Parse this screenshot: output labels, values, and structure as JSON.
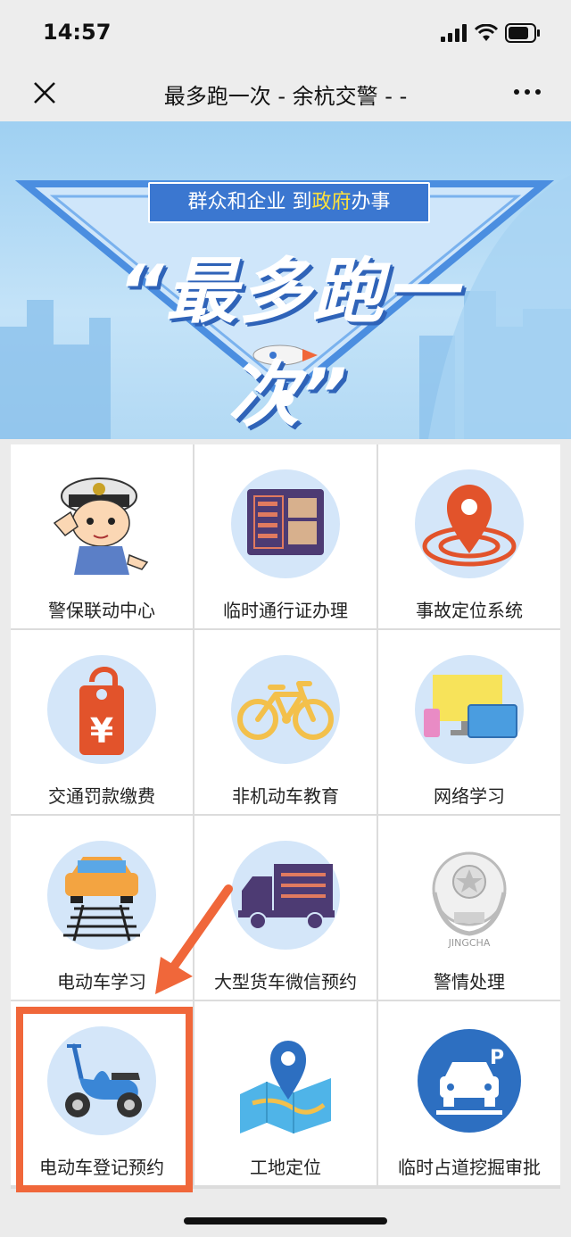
{
  "status": {
    "time": "14:57"
  },
  "nav": {
    "title": "最多跑一次 - 余杭交警 - -"
  },
  "banner": {
    "pill_part1": "群众和企业  到",
    "pill_highlight": "政府",
    "pill_part2": "办事",
    "headline": "“最多跑一次”"
  },
  "grid": [
    {
      "label": "警保联动中心",
      "icon": "police-officer-icon"
    },
    {
      "label": "临时通行证办理",
      "icon": "document-icon"
    },
    {
      "label": "事故定位系统",
      "icon": "location-pin-icon"
    },
    {
      "label": "交通罚款缴费",
      "icon": "yuan-tag-icon"
    },
    {
      "label": "非机动车教育",
      "icon": "bicycle-icon"
    },
    {
      "label": "网络学习",
      "icon": "devices-icon"
    },
    {
      "label": "电动车学习",
      "icon": "car-road-icon"
    },
    {
      "label": "大型货车微信预约",
      "icon": "truck-icon"
    },
    {
      "label": "警情处理",
      "icon": "police-emblem-icon"
    },
    {
      "label": "电动车登记预约",
      "icon": "scooter-icon"
    },
    {
      "label": "工地定位",
      "icon": "map-pin-icon"
    },
    {
      "label": "临时占道挖掘审批",
      "icon": "parking-car-icon"
    }
  ],
  "colors": {
    "accent": "#f0673a",
    "icon_bg": "#d4e6f9",
    "banner_blue": "#3b77d0"
  }
}
